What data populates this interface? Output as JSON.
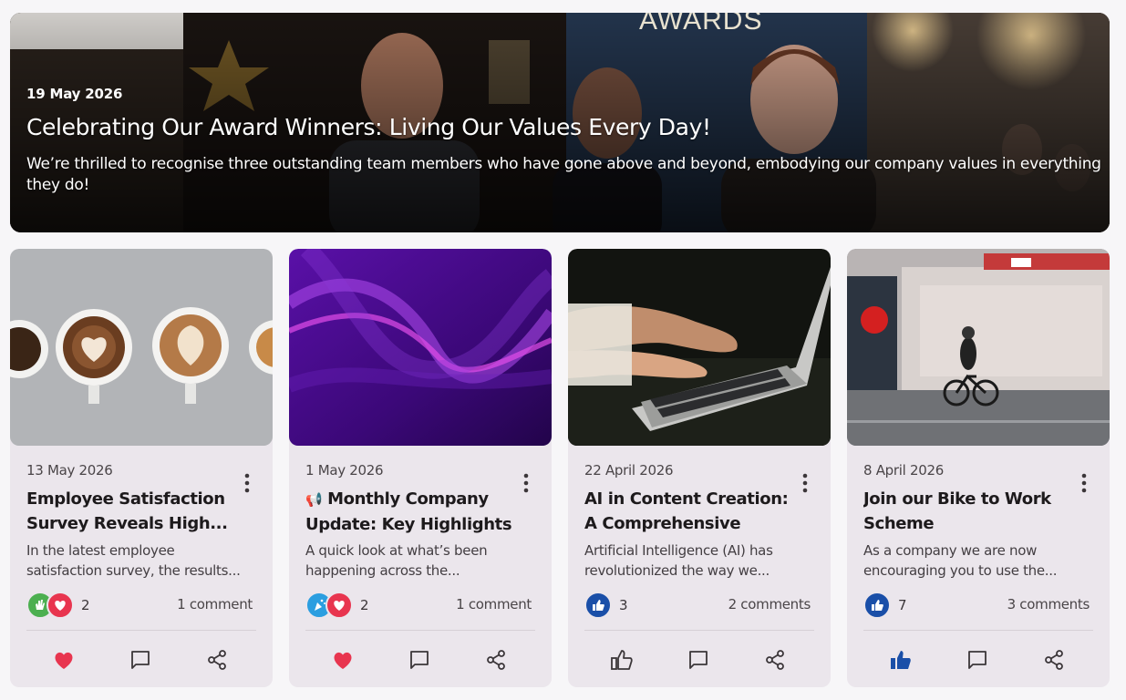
{
  "hero": {
    "date": "19 May 2026",
    "title": "Celebrating Our Award Winners: Living Our Values Every Day!",
    "text": "We’re thrilled to recognise three outstanding team members who have gone above and beyond, embodying our company values in everything they do!",
    "backdrop_sign": "AWARDS"
  },
  "cards": [
    {
      "date": "13 May 2026",
      "title": "Employee Satisfaction Survey Reveals High...",
      "excerpt": "In the latest employee satisfaction survey, the results...",
      "reaction_icons": [
        "clap-icon",
        "heart-icon"
      ],
      "reaction_count": "2",
      "comments": "1 comment",
      "actions": [
        "heart-filled-icon",
        "comment-icon",
        "share-icon"
      ]
    },
    {
      "date": "1 May 2026",
      "title_emoji": "📢",
      "title": "Monthly Company Update: Key Highlights",
      "excerpt": "A quick look at what’s been happening across the...",
      "reaction_icons": [
        "celebrate-icon",
        "heart-icon"
      ],
      "reaction_count": "2",
      "comments": "1 comment",
      "actions": [
        "heart-filled-icon",
        "comment-icon",
        "share-icon"
      ]
    },
    {
      "date": "22 April 2026",
      "title": "AI in Content Creation: A Comprehensive Loo...",
      "excerpt": "Artificial Intelligence (AI) has revolutionized the way we...",
      "reaction_icons": [
        "thumbs-up-icon"
      ],
      "reaction_count": "3",
      "comments": "2 comments",
      "actions": [
        "thumbs-up-outline-icon",
        "comment-icon",
        "share-icon"
      ]
    },
    {
      "date": "8 April 2026",
      "title": "Join our Bike to Work Scheme",
      "excerpt": "As a company we are now encouraging you to use the...",
      "reaction_icons": [
        "thumbs-up-icon"
      ],
      "reaction_count": "7",
      "comments": "3 comments",
      "actions": [
        "thumbs-up-filled-icon",
        "comment-icon",
        "share-icon"
      ]
    }
  ],
  "colors": {
    "heart": "#e8354f",
    "like_blue": "#1a4fa8",
    "clap_green": "#4caf50",
    "celebrate_blue": "#2b9ee0",
    "card_bg": "#ebe6ec"
  }
}
